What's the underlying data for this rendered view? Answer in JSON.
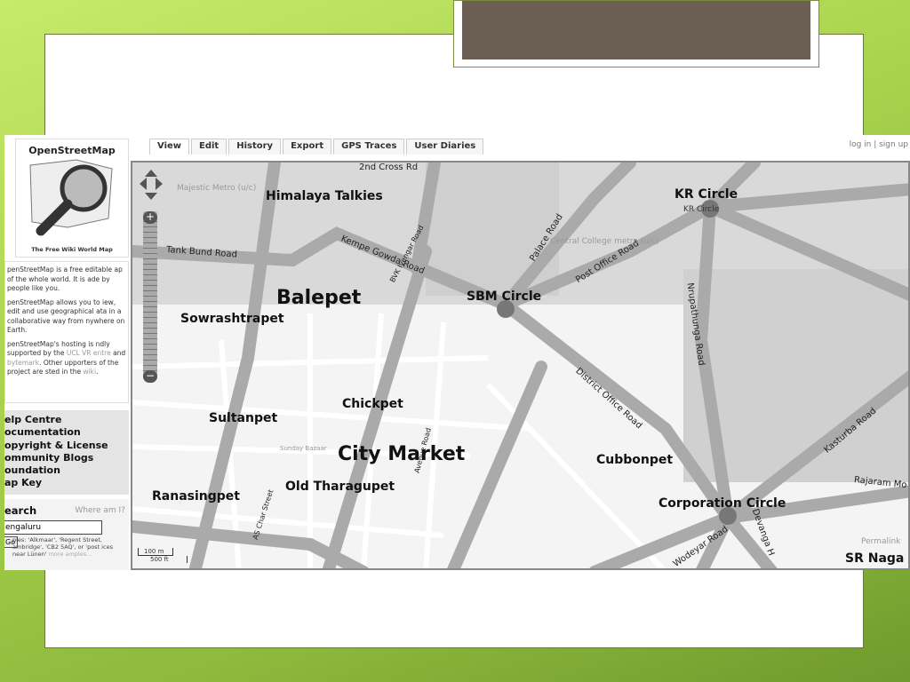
{
  "sidebar": {
    "logo_title": "OpenStreetMap",
    "logo_subtitle": "The Free Wiki World Map",
    "intro": [
      "penStreetMap is a free editable ap of the whole world. It is ade by people like you.",
      "penStreetMap allows you to iew, edit and use geographical ata in a collaborative way from nywhere on Earth."
    ],
    "hosting_pre": "penStreetMap's hosting is ndly supported by the ",
    "hosting_link1": "UCL VR entre",
    "hosting_and": " and ",
    "hosting_link2": "bytemark",
    "hosting_post": ". Other upporters of the project are sted in the ",
    "hosting_link3": "wiki",
    "links": [
      "elp Centre",
      "ocumentation",
      "opyright & License",
      "ommunity Blogs",
      "oundation",
      "ap Key"
    ],
    "search_heading": "earch",
    "where_am_i": "Where am I?",
    "search_value": "engaluru",
    "go_label": "Go",
    "examples": "ples: 'Alkmaar', 'Regent Street, ambridge', 'CB2 5AQ', or 'post ices near Lünen'",
    "more_examples": "more amples..."
  },
  "tabs": [
    "View",
    "Edit",
    "History",
    "Export",
    "GPS Traces",
    "User Diaries"
  ],
  "auth": "log in | sign up",
  "map": {
    "places": [
      "Himalaya Talkies",
      "Balepet",
      "Sowrashtrapet",
      "Chickpet",
      "Sultanpet",
      "City Market",
      "Old Tharagupet",
      "Ranasingpet",
      "Cubbonpet",
      "SBM Circle",
      "KR Circle",
      "Corporation Circle",
      "SR Naga"
    ],
    "roads": [
      "2nd Cross Rd",
      "Tank Bund Road",
      "Kempe Gowda Road",
      "BVK Iyengar Road",
      "Palace Road",
      "Post Office Road",
      "Nrupathunga Road",
      "District Office Road",
      "Kasturba Road",
      "Rajaram Mo",
      "AS Char Street",
      "Avenue Road",
      "Devanga H",
      "Wodeyar Road"
    ],
    "minor": [
      "Majestic Metro (u/c)",
      "Central College metro (u/c)",
      "KR Circle",
      "Sunday Bazaar",
      "Permalink"
    ],
    "scale_m": "100 m",
    "scale_ft": "500 ft",
    "zoom_in": "+",
    "zoom_out": "−"
  }
}
